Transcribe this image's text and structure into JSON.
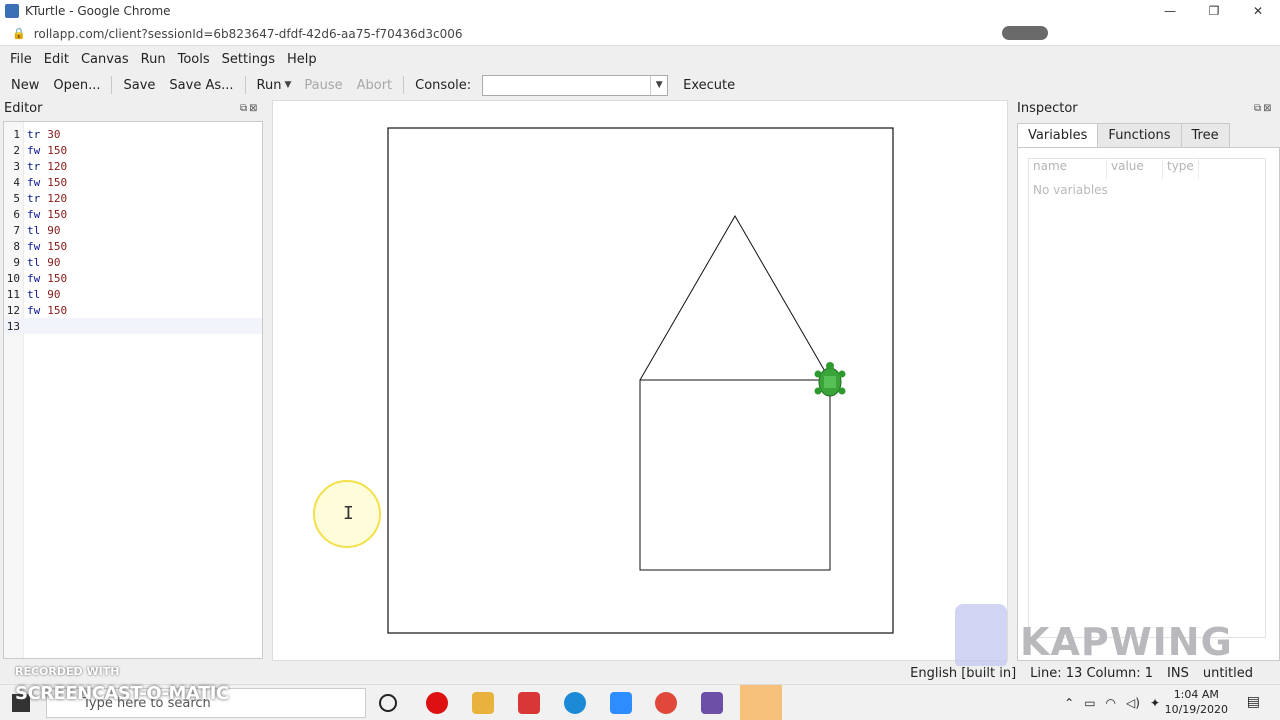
{
  "window": {
    "title": "KTurtle - Google Chrome",
    "url": "rollapp.com/client?sessionId=6b823647-dfdf-42d6-aa75-f70436d3c006"
  },
  "menu": [
    "File",
    "Edit",
    "Canvas",
    "Run",
    "Tools",
    "Settings",
    "Help"
  ],
  "toolbar": {
    "new": "New",
    "open": "Open...",
    "save": "Save",
    "save_as": "Save As...",
    "run": "Run",
    "pause": "Pause",
    "abort": "Abort",
    "console_label": "Console:",
    "console_value": "",
    "execute": "Execute"
  },
  "editor": {
    "title": "Editor",
    "lines": [
      {
        "n": "1",
        "cmd": "tr",
        "arg": "30"
      },
      {
        "n": "2",
        "cmd": "fw",
        "arg": "150"
      },
      {
        "n": "3",
        "cmd": "tr",
        "arg": "120"
      },
      {
        "n": "4",
        "cmd": "fw",
        "arg": "150"
      },
      {
        "n": "5",
        "cmd": "tr",
        "arg": "120"
      },
      {
        "n": "6",
        "cmd": "fw",
        "arg": "150"
      },
      {
        "n": "7",
        "cmd": "tl",
        "arg": "90"
      },
      {
        "n": "8",
        "cmd": "fw",
        "arg": "150"
      },
      {
        "n": "9",
        "cmd": "tl",
        "arg": "90"
      },
      {
        "n": "10",
        "cmd": "fw",
        "arg": "150"
      },
      {
        "n": "11",
        "cmd": "tl",
        "arg": "90"
      },
      {
        "n": "12",
        "cmd": "fw",
        "arg": "150"
      },
      {
        "n": "13",
        "cmd": "",
        "arg": ""
      }
    ],
    "current_line": 13
  },
  "inspector": {
    "title": "Inspector",
    "tabs": [
      "Variables",
      "Functions",
      "Tree"
    ],
    "active_tab": "Variables",
    "columns": [
      "name",
      "value",
      "type"
    ],
    "empty_text": "No variables"
  },
  "statusbar": {
    "language": "English [built in]",
    "position": "Line: 13 Column: 1",
    "mode": "INS",
    "file": "untitled"
  },
  "watermarks": {
    "recorded_with": "RECORDED WITH",
    "screencast": "SCREENCAST-O-MATIC",
    "kapwing": "KAPWING"
  },
  "taskbar": {
    "search_placeholder": "Type here to search",
    "time": "1:04 AM",
    "date": "10/19/2020"
  },
  "colors": {
    "turtle": "#2e9a2e",
    "cursor_highlight": "#f3e04a"
  }
}
